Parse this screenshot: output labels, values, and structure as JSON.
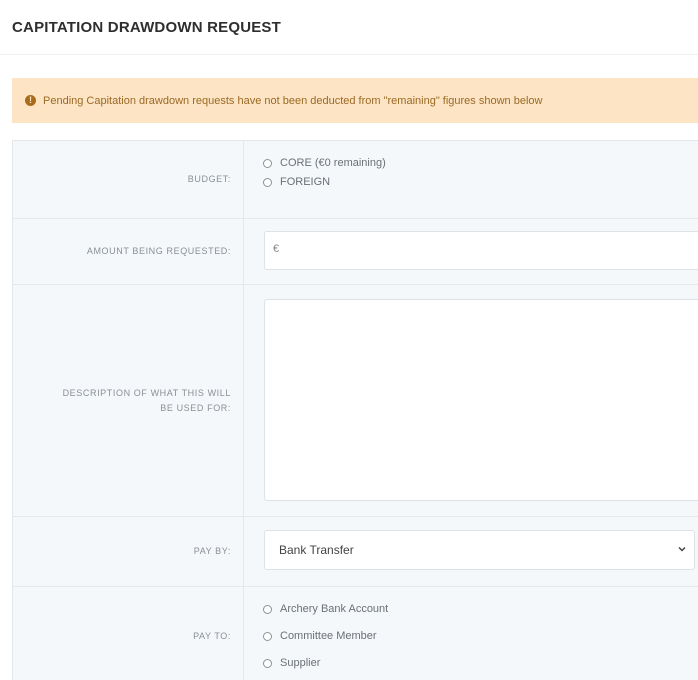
{
  "page": {
    "title": "CAPITATION DRAWDOWN REQUEST"
  },
  "alert": {
    "icon": "exclamation-circle-icon",
    "icon_glyph": "!",
    "text": "Pending Capitation drawdown requests have not been deducted from \"remaining\" figures shown below"
  },
  "form": {
    "budget": {
      "label": "BUDGET:",
      "options": [
        {
          "label": "CORE (€0 remaining)",
          "selected": false
        },
        {
          "label": "FOREIGN",
          "selected": false
        }
      ]
    },
    "amount": {
      "label": "AMOUNT BEING REQUESTED:",
      "prefix": "€",
      "value": ""
    },
    "description": {
      "label_line1": "DESCRIPTION OF WHAT THIS WILL",
      "label_line2": "BE USED FOR:",
      "value": ""
    },
    "pay_by": {
      "label": "PAY BY:",
      "selected": "Bank Transfer"
    },
    "pay_to": {
      "label": "PAY TO:",
      "options": [
        {
          "label": "Archery Bank Account",
          "selected": false
        },
        {
          "label": "Committee Member",
          "selected": false
        },
        {
          "label": "Supplier",
          "selected": false
        }
      ]
    }
  },
  "colors": {
    "alert_bg": "#fde4c4",
    "alert_text": "#9a6a25",
    "row_bg": "#f4f8fb",
    "border": "#e3e8ed"
  }
}
